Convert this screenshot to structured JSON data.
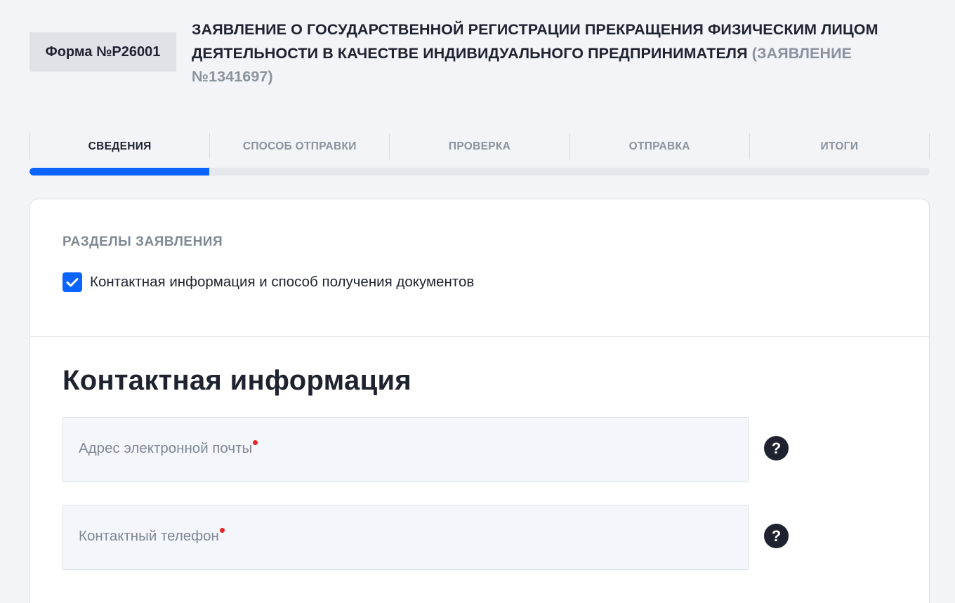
{
  "header": {
    "form_badge": "Форма №Р26001",
    "title_main": "ЗАЯВЛЕНИЕ О ГОСУДАРСТВЕННОЙ РЕГИСТРАЦИИ ПРЕКРАЩЕНИЯ ФИЗИЧЕСКИМ ЛИЦОМ ДЕЯТЕЛЬНОСТИ В КАЧЕСТВЕ ИНДИВИДУАЛЬНОГО ПРЕДПРИНИМАТЕЛЯ",
    "title_suffix": "(ЗАЯВЛЕНИЕ №1341697)"
  },
  "steps": [
    {
      "label": "СВЕДЕНИЯ",
      "active": true
    },
    {
      "label": "СПОСОБ ОТПРАВКИ",
      "active": false
    },
    {
      "label": "ПРОВЕРКА",
      "active": false
    },
    {
      "label": "ОТПРАВКА",
      "active": false
    },
    {
      "label": "ИТОГИ",
      "active": false
    }
  ],
  "progress": {
    "current_step": 1,
    "total_steps": 5,
    "fraction": 0.2
  },
  "sections": {
    "title": "РАЗДЕЛЫ ЗАЯВЛЕНИЯ",
    "items": [
      {
        "label": "Контактная информация и способ получения документов",
        "checked": true
      }
    ]
  },
  "contact": {
    "heading": "Контактная информация",
    "email_label": "Адрес электронной почты",
    "email_value": "",
    "phone_label": "Контактный телефон",
    "phone_value": "",
    "help_glyph": "?"
  },
  "colors": {
    "accent": "#0a64ff",
    "required": "#e32626",
    "background": "#f2f4f7",
    "text": "#1f2330",
    "muted": "#8a929c"
  },
  "icons": [
    "check-icon",
    "help-icon"
  ]
}
